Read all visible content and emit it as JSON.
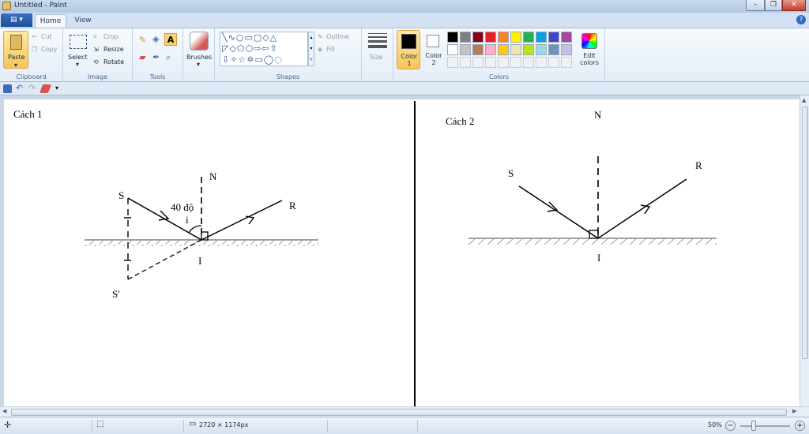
{
  "window": {
    "title": "Untitled - Paint",
    "minimize": "–",
    "maximize": "❐",
    "close": "✕"
  },
  "tabs": {
    "file": "▤ ▾",
    "home": "Home",
    "view": "View",
    "help": "?"
  },
  "ribbon": {
    "clipboard": {
      "label": "Clipboard",
      "paste": "Paste",
      "cut": "Cut",
      "copy": "Copy"
    },
    "image": {
      "label": "Image",
      "select": "Select",
      "crop": "Crop",
      "resize": "Resize",
      "rotate": "Rotate"
    },
    "tools": {
      "label": "Tools"
    },
    "brushes": {
      "label": "Brushes"
    },
    "shapes": {
      "label": "Shapes",
      "outline": "Outline",
      "fill": "Fill"
    },
    "size": {
      "label": "Size"
    },
    "colors": {
      "label": "Colors",
      "color1": "Color 1",
      "color2": "Color 2",
      "edit": "Edit colors",
      "color1_value": "#000000",
      "color2_value": "#ffffff",
      "palette": [
        "#000000",
        "#7f7f7f",
        "#880015",
        "#ed1c24",
        "#ff7f27",
        "#fff200",
        "#22b14c",
        "#00a2e8",
        "#3f48cc",
        "#a349a4",
        "#ffffff",
        "#c3c3c3",
        "#b97a57",
        "#ffaec9",
        "#ffc90e",
        "#efe4b0",
        "#b5e61d",
        "#99d9ea",
        "#7092be",
        "#c8bfe7"
      ]
    }
  },
  "drawing": {
    "left": {
      "heading": "Cách 1",
      "S": "S",
      "S_prime": "S'",
      "N": "N",
      "R": "R",
      "I": "I",
      "angle_label": "40 độ",
      "i": "i"
    },
    "right": {
      "heading": "Cách 2",
      "S": "S",
      "N": "N",
      "R": "R",
      "I": "I"
    }
  },
  "status": {
    "dimensions": "2720 × 1174px",
    "zoom": "50%",
    "zoom_out": "−",
    "zoom_in": "+"
  }
}
